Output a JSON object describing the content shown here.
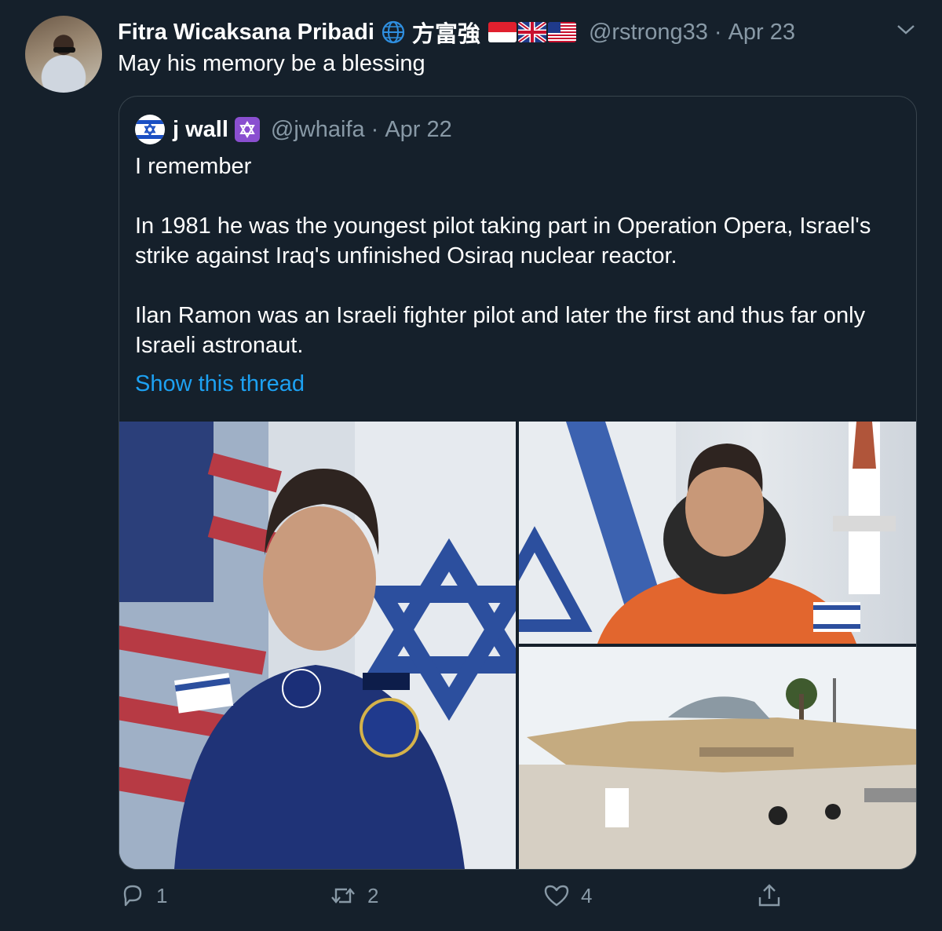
{
  "tweet": {
    "display_name": "Fitra Wicaksana Pribadi",
    "name_suffix": "方富強",
    "handle": "@rstrong33",
    "separator": "·",
    "date": "Apr 23",
    "text": "May his memory be a blessing",
    "icons": [
      "globe-icon",
      "indonesia-flag",
      "uk-flag",
      "us-flag",
      "chevron-down-icon"
    ]
  },
  "quoted": {
    "display_name": "j wall",
    "handle": "@jwhaifa",
    "separator": "·",
    "date": "Apr 22",
    "paragraphs": [
      "I remember",
      "In 1981 he was the youngest pilot taking part in Operation Opera, Israel's strike against Iraq's unfinished Osiraq nuclear reactor.",
      "Ilan Ramon was an Israeli fighter pilot and later the first and thus far only Israeli astronaut."
    ],
    "show_thread": "Show this thread",
    "media": [
      "astronaut portrait with flags",
      "astronaut in orange suit with space shuttle",
      "fighter jet on display"
    ]
  },
  "actions": {
    "reply_count": "1",
    "retweet_count": "2",
    "like_count": "4"
  },
  "colors": {
    "background": "#15202b",
    "secondary_text": "#8899a6",
    "link": "#1da1f2",
    "border": "#38444d"
  }
}
